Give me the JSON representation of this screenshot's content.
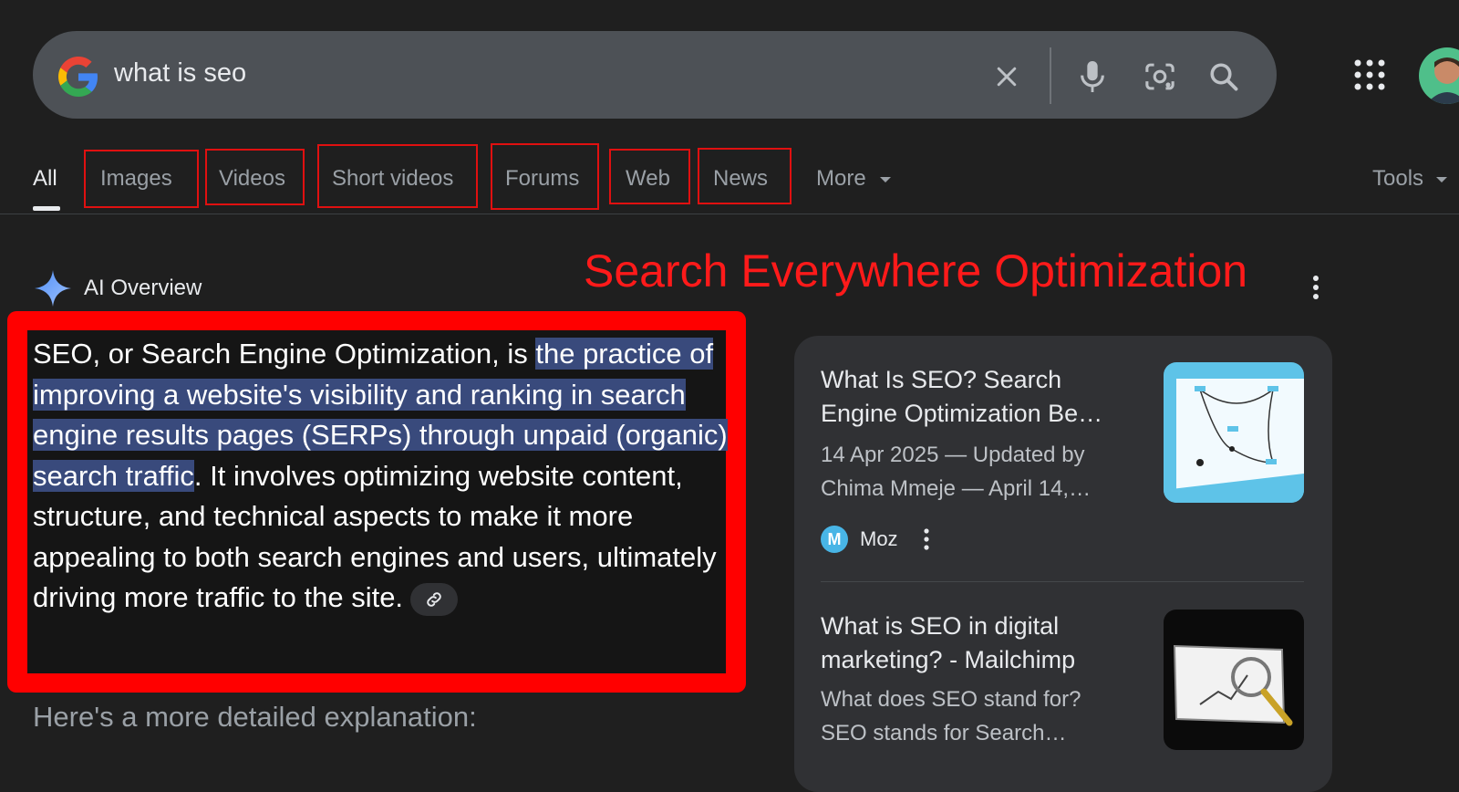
{
  "search": {
    "query": "what is seo"
  },
  "tabs": [
    {
      "label": "All"
    },
    {
      "label": "Images"
    },
    {
      "label": "Videos"
    },
    {
      "label": "Short videos"
    },
    {
      "label": "Forums"
    },
    {
      "label": "Web"
    },
    {
      "label": "News"
    },
    {
      "label": "More"
    }
  ],
  "tools_label": "Tools",
  "annotation": {
    "heading": "Search Everywhere Optimization",
    "color": "#ff1a1a"
  },
  "ai_overview": {
    "title": "AI Overview",
    "text_before": "SEO, or Search Engine Optimization, is ",
    "text_highlight": "the practice of improving a website's visibility and ranking in search engine results pages (SERPs) through unpaid (organic) search traffic",
    "text_after": ". It involves optimizing website content, structure, and technical aspects to make it more appealing to both search engines and users, ultimately driving more traffic to the site.",
    "more_label": "Here's a more detailed explanation:"
  },
  "sources": [
    {
      "title": "What Is SEO? Search Engine Optimization Be…",
      "snippet_line1": "14 Apr 2025 — Updated by",
      "snippet_line2": "Chima Mmeje — April 14,…",
      "site": "Moz",
      "site_initial": "M"
    },
    {
      "title": "What is SEO in digital marketing? - Mailchimp",
      "snippet_line1": "What does SEO stand for?",
      "snippet_line2": "SEO stands for Search…"
    }
  ]
}
